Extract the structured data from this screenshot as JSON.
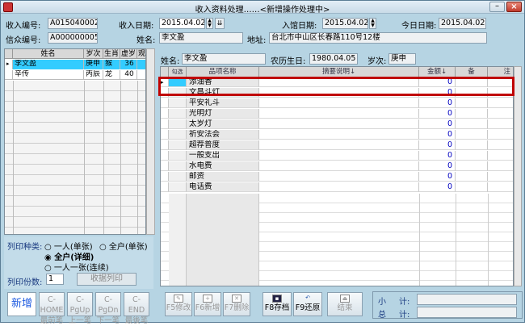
{
  "window": {
    "title": "收入资料处理……<新增操作处理中>",
    "min_label": "–",
    "close_label": "×"
  },
  "header": {
    "income_no_label": "收入编号:",
    "income_no": "A015040002",
    "income_date_label": "收入日期:",
    "income_date": "2015.04.02",
    "entry_date_label": "入馆日期:",
    "entry_date": "2015.04.02",
    "today_label": "今日日期:",
    "today": "2015.04.02",
    "believer_no_label": "信众编号:",
    "believer_no": "A000000005",
    "name_label": "姓名:",
    "name": "李文盈",
    "address_label": "地址:",
    "address": "台北市中山区长春路110号12楼"
  },
  "left_table": {
    "columns": [
      "姓名",
      "岁次",
      "生肖",
      "虚岁",
      "观"
    ],
    "rows": [
      {
        "name": "李文盈",
        "year": "庚申",
        "zodiac": "猴",
        "age": "36",
        "extra": ""
      },
      {
        "name": "辛传",
        "year": "丙辰",
        "zodiac": "龙",
        "age": "40",
        "extra": ""
      }
    ],
    "indicator": "▸"
  },
  "print_options": {
    "type_label": "列印种类:",
    "opt1": "一人(单张)",
    "opt2": "全户(单张)",
    "opt3": "全户(详细)",
    "opt4": "一人一张(连续)",
    "copies_label": "列印份数:",
    "copies": "1",
    "receipt_button": "收据列印"
  },
  "person": {
    "name_label": "姓名:",
    "name": "李文盈",
    "lunar_label": "农历生日:",
    "lunar": "1980.04.05",
    "year_label": "岁次:",
    "year": "庚申"
  },
  "right_table": {
    "columns": [
      "勾选",
      "品项名称",
      "摘要说明↓",
      "金额↓",
      "备",
      "注"
    ],
    "rows": [
      {
        "item": "添油香",
        "amount": "0"
      },
      {
        "item": "文昌斗灯",
        "amount": "0"
      },
      {
        "item": "平安礼斗",
        "amount": "0"
      },
      {
        "item": "光明灯",
        "amount": "0"
      },
      {
        "item": "太岁灯",
        "amount": "0"
      },
      {
        "item": "祈安法会",
        "amount": "0"
      },
      {
        "item": "超荐普度",
        "amount": "0"
      },
      {
        "item": "一般支出",
        "amount": "0"
      },
      {
        "item": "水电费",
        "amount": "0"
      },
      {
        "item": "邮资",
        "amount": "0"
      },
      {
        "item": "电话费",
        "amount": "0"
      }
    ]
  },
  "toolbar": {
    "new": "新增",
    "home": [
      "C-HOME",
      "最前笔"
    ],
    "pgup": [
      "C-PgUp",
      "上一笔"
    ],
    "pgdn": [
      "C-PgDn",
      "下一笔"
    ],
    "end": [
      "C-END",
      "最後笔"
    ],
    "f5": "F5修改",
    "f6": "F6新增",
    "f7": "F7删除",
    "f8": "F8存档",
    "f9": "F9还原",
    "close": "结束"
  },
  "summary": {
    "small_label": "小",
    "small_suffix": "计:",
    "total_label": "总",
    "total_suffix": "计:"
  },
  "colors": {
    "accent": "#1e5be0",
    "selection": "#33ccff",
    "highlight": "#c00000",
    "amount": "#0000c0"
  }
}
